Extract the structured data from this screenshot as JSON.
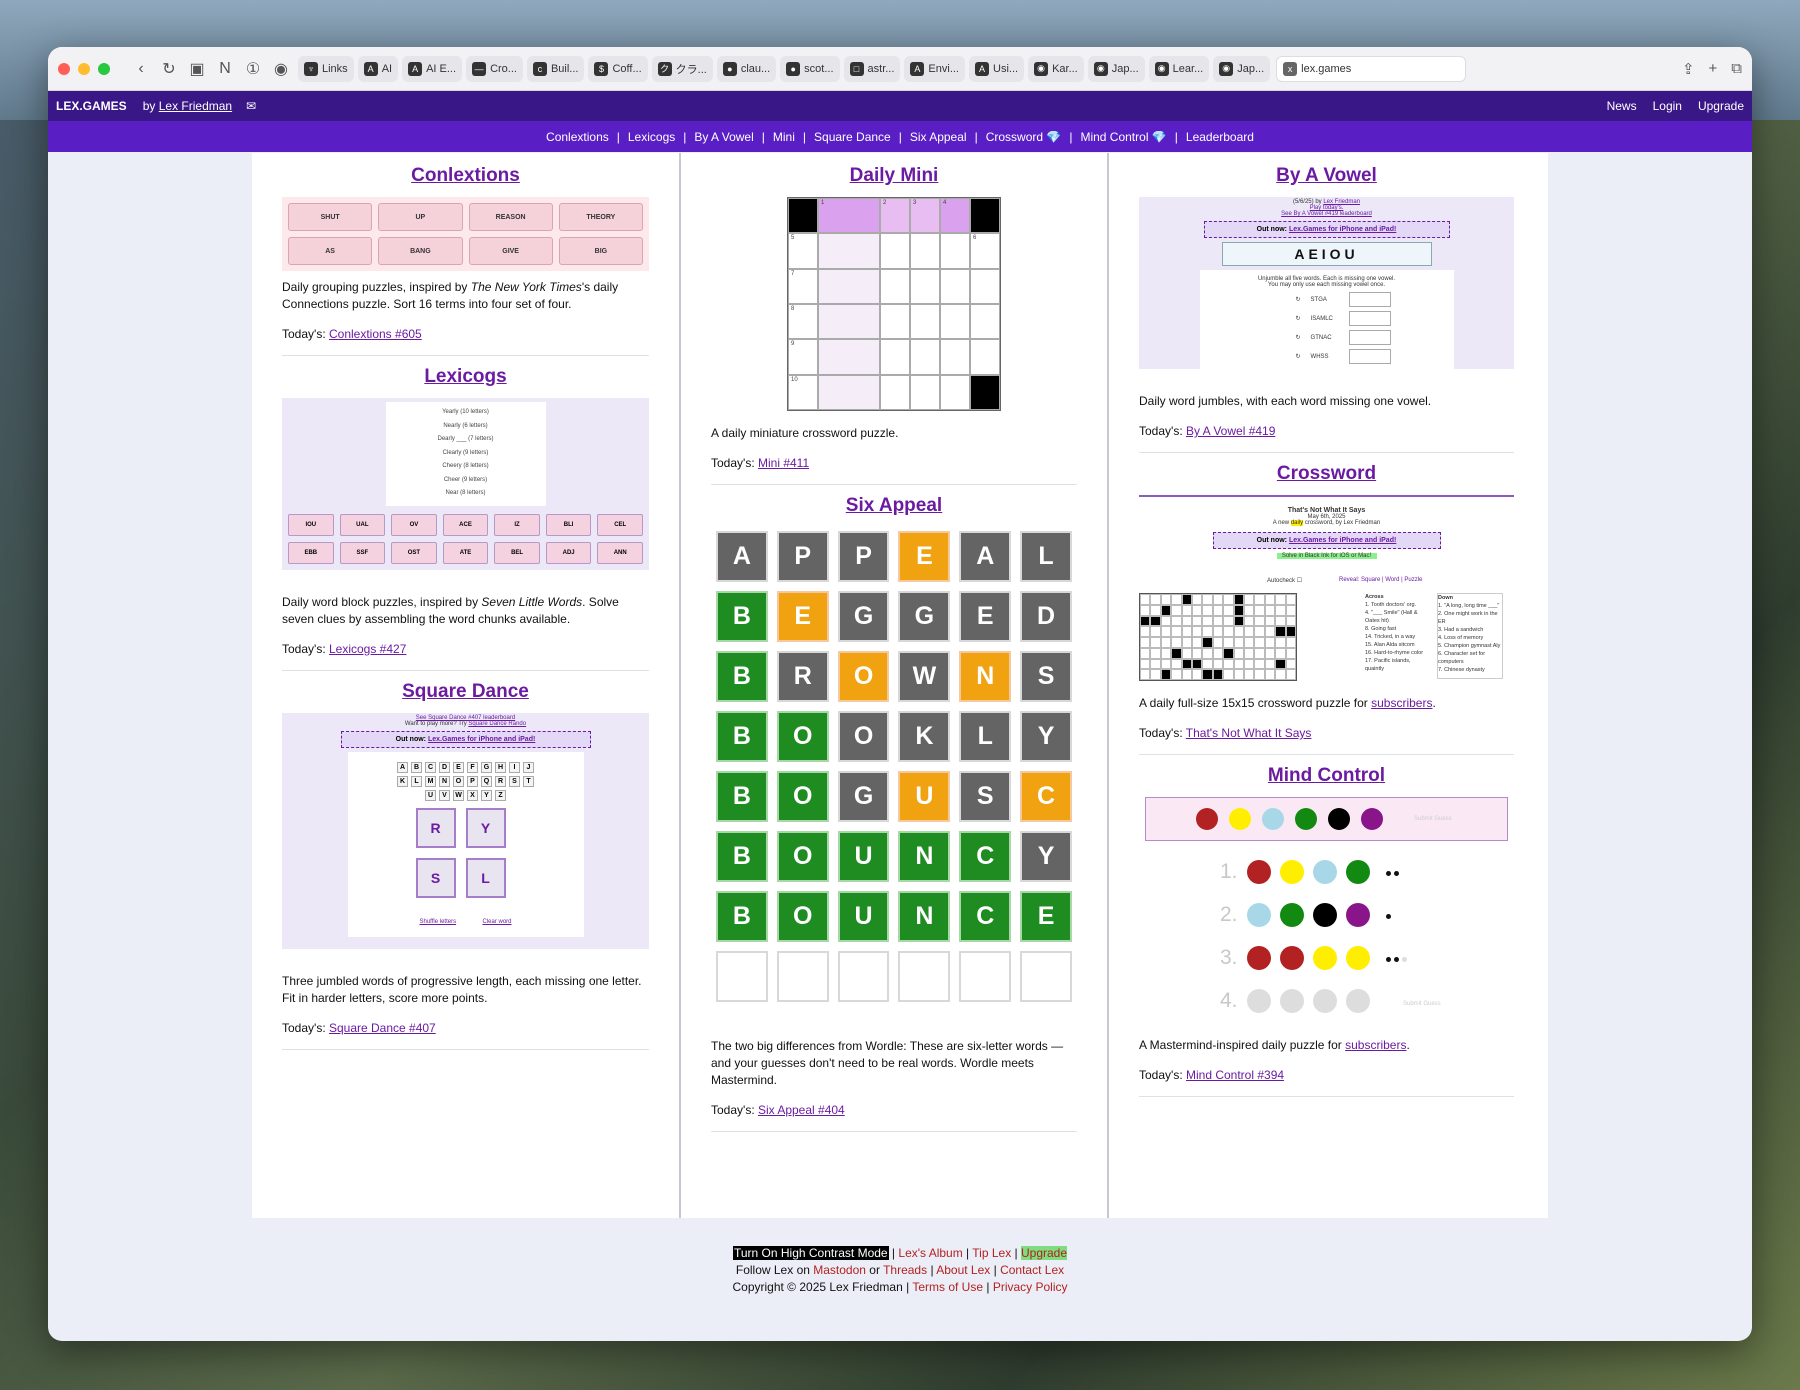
{
  "browser": {
    "tabs": [
      {
        "label": "Links",
        "icon": "♆"
      },
      {
        "label": "AI",
        "icon": "A"
      },
      {
        "label": "AI E...",
        "icon": "A"
      },
      {
        "label": "Cro...",
        "icon": "—"
      },
      {
        "label": "Buil...",
        "icon": "c"
      },
      {
        "label": "Coff...",
        "icon": "$"
      },
      {
        "label": "クラ...",
        "icon": "ク"
      },
      {
        "label": "clau...",
        "icon": "●"
      },
      {
        "label": "scot...",
        "icon": "●"
      },
      {
        "label": "astr...",
        "icon": "□"
      },
      {
        "label": "Envi...",
        "icon": "A"
      },
      {
        "label": "Usi...",
        "icon": "A"
      },
      {
        "label": "Kar...",
        "icon": "◉"
      },
      {
        "label": "Jap...",
        "icon": "◉"
      },
      {
        "label": "Lear...",
        "icon": "◉"
      },
      {
        "label": "Jap...",
        "icon": "◉"
      }
    ],
    "active_tab": "lex.games"
  },
  "topbar": {
    "brand": "LEX.GAMES",
    "by": "by",
    "author": "Lex Friedman",
    "links": [
      "News",
      "Login",
      "Upgrade"
    ]
  },
  "subnav": [
    "Conlextions",
    "|",
    "Lexicogs",
    "|",
    "By A Vowel",
    "|",
    "Mini",
    "|",
    "Square Dance",
    "|",
    "Six Appeal",
    "|",
    "Crossword 💎",
    "|",
    "Mind Control 💎",
    "|",
    "Leaderboard"
  ],
  "conlextions": {
    "title": "Conlextions",
    "tiles": [
      "SHUT",
      "UP",
      "REASON",
      "THEORY",
      "AS",
      "BANG",
      "GIVE",
      "BIG"
    ],
    "desc_a": "Daily grouping puzzles, inspired by ",
    "desc_em": "The New York Times",
    "desc_b": "'s daily Connections puzzle. Sort 16 terms into four set of four.",
    "today_label": "Today's: ",
    "today_link": "Conlextions #605"
  },
  "lexicogs": {
    "title": "Lexicogs",
    "clues": [
      "Yearly (10 letters)",
      "Nearly (6 letters)",
      "Dearly ___ (7 letters)",
      "Clearly (9 letters)",
      "Cheery (8 letters)",
      "Cheer (9 letters)",
      "Near (8 letters)"
    ],
    "chunks": [
      "IOU",
      "UAL",
      "OV",
      "ACE",
      "IZ",
      "BLI",
      "CEL",
      "EBB",
      "SSF",
      "OST",
      "ATE",
      "BEL",
      "ADJ",
      "ANN"
    ],
    "desc_a": "Daily word block puzzles, inspired by ",
    "desc_em": "Seven Little Words",
    "desc_b": ". Solve seven clues by assembling the word chunks available.",
    "today_label": "Today's: ",
    "today_link": "Lexicogs #427"
  },
  "square_dance": {
    "title": "Square Dance",
    "lb_link": "See Square Dance #407 leaderboard",
    "want_more": "Want to play more? Try ",
    "rando": "Square Dance Rando",
    "outnow_a": "Out now: ",
    "outnow_link": "Lex.Games for iPhone and iPad!",
    "letters": [
      "A",
      "B",
      "C",
      "D",
      "E",
      "F",
      "G",
      "H",
      "I",
      "J",
      "K",
      "L",
      "M",
      "N",
      "O",
      "P",
      "Q",
      "R",
      "S",
      "T",
      "U",
      "V",
      "W",
      "X",
      "Y",
      "Z"
    ],
    "squares": [
      "R",
      "Y",
      "S",
      "L"
    ],
    "shuffle": "Shuffle letters",
    "clear": "Clear word",
    "desc": "Three jumbled words of progressive length, each missing one letter. Fit in harder letters, score more points.",
    "today_label": "Today's: ",
    "today_link": "Square Dance #407"
  },
  "mini": {
    "title": "Daily Mini",
    "numbers": [
      "1",
      "2",
      "3",
      "4",
      "5",
      "6",
      "7",
      "8",
      "9",
      "10"
    ],
    "desc": "A daily miniature crossword puzzle.",
    "today_label": "Today's: ",
    "today_link": "Mini #411"
  },
  "six_appeal": {
    "title": "Six Appeal",
    "rows": [
      [
        "A",
        "P",
        "P",
        "E",
        "A",
        "L"
      ],
      [
        "B",
        "E",
        "G",
        "G",
        "E",
        "D"
      ],
      [
        "B",
        "R",
        "O",
        "W",
        "N",
        "S"
      ],
      [
        "B",
        "O",
        "O",
        "K",
        "L",
        "Y"
      ],
      [
        "B",
        "O",
        "G",
        "U",
        "S",
        "C"
      ],
      [
        "B",
        "O",
        "U",
        "N",
        "C",
        "Y"
      ],
      [
        "B",
        "O",
        "U",
        "N",
        "C",
        "E"
      ],
      [
        "",
        "",
        "",
        "",
        "",
        ""
      ]
    ],
    "states": [
      [
        "g",
        "g",
        "g",
        "y",
        "g",
        "g"
      ],
      [
        "gr",
        "y",
        "g",
        "g",
        "g",
        "g"
      ],
      [
        "gr",
        "g",
        "y",
        "g",
        "y",
        "g"
      ],
      [
        "gr",
        "gr",
        "g",
        "g",
        "g",
        "g"
      ],
      [
        "gr",
        "gr",
        "g",
        "y",
        "g",
        "y"
      ],
      [
        "gr",
        "gr",
        "gr",
        "gr",
        "gr",
        "g"
      ],
      [
        "gr",
        "gr",
        "gr",
        "gr",
        "gr",
        "gr"
      ],
      [
        "e",
        "e",
        "e",
        "e",
        "e",
        "e"
      ]
    ],
    "desc": "The two big differences from Wordle: These are six-letter words — and your guesses don't need to be real words. Wordle meets Mastermind.",
    "today_label": "Today's: ",
    "today_link": "Six Appeal #404"
  },
  "by_a_vowel": {
    "title": "By A Vowel",
    "head_date": "(5/6/25) by ",
    "head_author": "Lex Friedman",
    "play": "Play today's.",
    "lb": "See By A Vowel #419 leaderboard",
    "outnow_a": "Out now: ",
    "outnow_link": "Lex.Games for iPhone and iPad!",
    "vowels": "AEIOU",
    "inst1": "Unjumble all five words. Each is missing one vowel.",
    "inst2": "You may only use each missing vowel once.",
    "words": [
      "STGA",
      "ISAMLC",
      "GTNAC",
      "WHSS"
    ],
    "desc": "Daily word jumbles, with each word missing one vowel.",
    "today_label": "Today's: ",
    "today_link": "By A Vowel #419"
  },
  "crossword": {
    "title": "Crossword",
    "cw_title": "That's Not What It Says",
    "cw_date": "May 6th, 2025",
    "cw_sub_a": "A new ",
    "cw_sub_hl": "daily",
    "cw_sub_b": " crossword, by Lex Friedman",
    "outnow_a": "Out now: ",
    "outnow_link": "Lex.Games for iPhone and iPad!",
    "solve": "Solve in Black Ink for iOS or Mac!",
    "autocheck": "Autocheck",
    "reveal": "Reveal: Square | Word | Puzzle",
    "across_h": "Across",
    "across": [
      "1. Tooth doctors' org.",
      "4. \"___ Smile\" (Hall & Oates hit)",
      "8. Going fast",
      "14. Tricked, in a way",
      "15. Alan Alda sitcom",
      "16. Hard-to-rhyme color",
      "17. Pacific islands, quaintly"
    ],
    "down_h": "Down",
    "down": [
      "1. \"A long, long time ___\"",
      "2. One might work in the ER",
      "3. Had a sandwich",
      "4. Loss of memory",
      "5. Champion gymnast Aly",
      "6. Character set for computers",
      "7. Chinese dynasty"
    ],
    "desc_a": "A daily full-size 15x15 crossword puzzle for ",
    "desc_link": "subscribers",
    "desc_b": ".",
    "today_label": "Today's: ",
    "today_link": "That's Not What It Says"
  },
  "mind_control": {
    "title": "Mind Control",
    "palette": [
      "#b22222",
      "#ffee00",
      "#a8d8e8",
      "#128a12",
      "#000000",
      "#8a158a"
    ],
    "submit": "Submit Guess",
    "guesses": [
      {
        "num": "1.",
        "colors": [
          "#b22222",
          "#ffee00",
          "#a8d8e8",
          "#128a12"
        ],
        "black": 2,
        "white": 0
      },
      {
        "num": "2.",
        "colors": [
          "#a8d8e8",
          "#128a12",
          "#000000",
          "#8a158a"
        ],
        "black": 1,
        "white": 0
      },
      {
        "num": "3.",
        "colors": [
          "#b22222",
          "#b22222",
          "#ffee00",
          "#ffee00"
        ],
        "black": 2,
        "white": 1
      },
      {
        "num": "4.",
        "colors": [
          "#dddddd",
          "#dddddd",
          "#dddddd",
          "#dddddd"
        ],
        "black": 0,
        "white": 0
      }
    ],
    "desc_a": "A Mastermind-inspired daily puzzle for ",
    "desc_link": "subscribers",
    "desc_b": ".",
    "today_label": "Today's: ",
    "today_link": "Mind Control #394"
  },
  "footer": {
    "hc": "Turn On High Contrast Mode",
    "album": "Lex's Album",
    "tip": "Tip Lex",
    "upgrade": "Upgrade",
    "follow_a": "Follow Lex on ",
    "mastodon": "Mastodon",
    "or": " or ",
    "threads": "Threads",
    "about": "About Lex",
    "contact": "Contact Lex",
    "copyright": "Copyright © 2025 Lex Friedman | ",
    "terms": "Terms of Use",
    "privacy": "Privacy Policy",
    "sep": " | "
  }
}
